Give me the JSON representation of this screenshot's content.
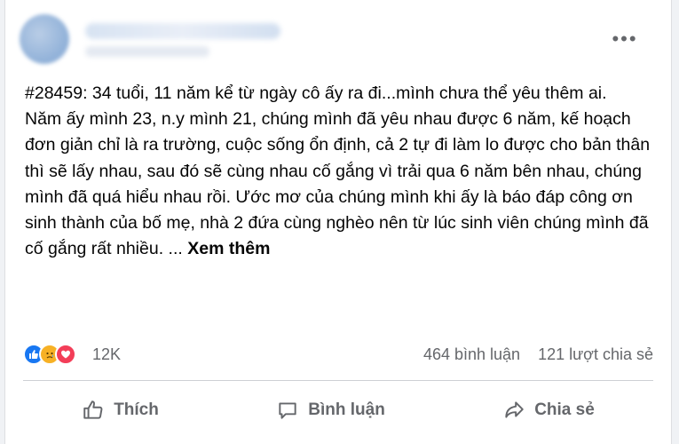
{
  "post": {
    "menu_icon": "more-horizontal-icon",
    "menu_label": "•••",
    "title_line": "#28459: 34 tuổi, 11 năm kể từ ngày cô ấy ra đi...mình chưa thể yêu thêm ai.",
    "body": "Năm ấy mình 23, n.y mình 21, chúng mình đã yêu nhau được 6 năm, kế hoạch đơn giản chỉ là ra trường, cuộc sống ổn định, cả 2 tự đi làm lo được cho bản thân thì sẽ lấy nhau, sau đó sẽ cùng nhau cố gắng vì trải qua 6 năm bên nhau, chúng mình đã quá hiểu nhau rồi. Ước mơ của chúng mình khi ấy là báo đáp công ơn sinh thành của bố mẹ, nhà 2 đứa cùng nghèo nên từ lúc sinh viên chúng mình đã cố gắng rất nhiều. ...",
    "see_more": "Xem thêm"
  },
  "stats": {
    "reaction_icons": [
      "like-icon",
      "sad-icon",
      "love-icon"
    ],
    "reaction_colors": {
      "like": "#1877f2",
      "sad": "#f7b125",
      "love": "#f33e58"
    },
    "reaction_count": "12K",
    "comments": "464 bình luận",
    "shares": "121 lượt chia sẻ"
  },
  "actions": {
    "like": "Thích",
    "comment": "Bình luận",
    "share": "Chia sẻ"
  }
}
